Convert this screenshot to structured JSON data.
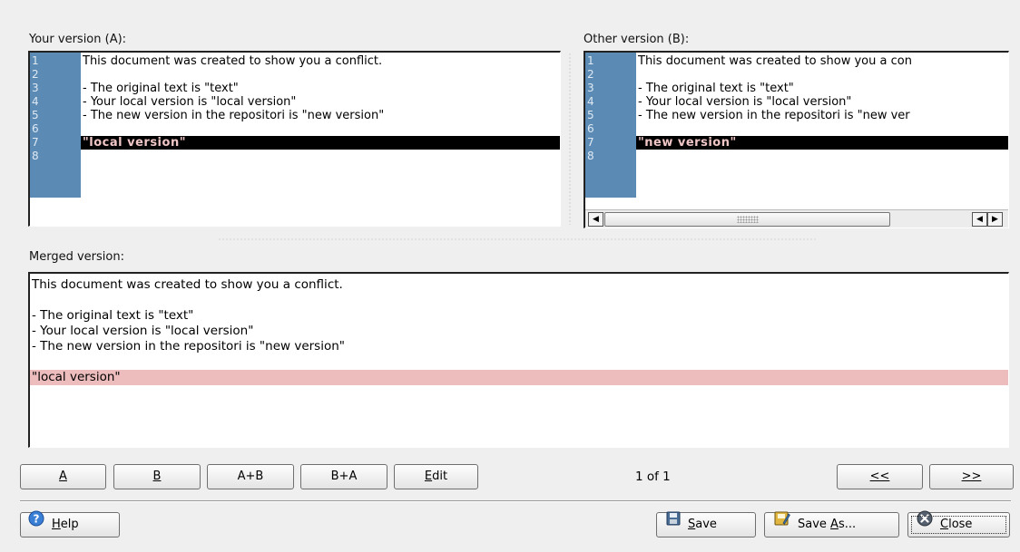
{
  "pane_a": {
    "label": "Your version (A):",
    "lines": [
      {
        "num": "1",
        "text": "This document was created to show you a conflict."
      },
      {
        "num": "2",
        "text": ""
      },
      {
        "num": "3",
        "text": "- The original text is \"text\""
      },
      {
        "num": "4",
        "text": "- Your local version is \"local version\""
      },
      {
        "num": "5",
        "text": "- The new version in the repositori is \"new version\""
      },
      {
        "num": "6",
        "text": ""
      },
      {
        "num": "7",
        "text": "\"local version\""
      },
      {
        "num": "8",
        "text": ""
      }
    ]
  },
  "pane_b": {
    "label": "Other version (B):",
    "lines": [
      {
        "num": "1",
        "text": "This document was created to show you a con"
      },
      {
        "num": "2",
        "text": ""
      },
      {
        "num": "3",
        "text": "- The original text is \"text\""
      },
      {
        "num": "4",
        "text": "- Your local version is \"local version\""
      },
      {
        "num": "5",
        "text": "- The new version in the repositori is \"new ver"
      },
      {
        "num": "6",
        "text": ""
      },
      {
        "num": "7",
        "text": "\"new version\""
      },
      {
        "num": "8",
        "text": ""
      }
    ],
    "scroll_left_glyph": "◀",
    "scroll_right_glyph": "▶"
  },
  "merged": {
    "label": "Merged version:",
    "lines": [
      "This document was created to show you a conflict.",
      "",
      "- The original text is \"text\"",
      "- Your local version is \"local version\"",
      "- The new version in the repositori is \"new version\"",
      "",
      "\"local version\""
    ]
  },
  "toolbar": {
    "a_label": "A",
    "b_label": "B",
    "a_plus_b_label": "A+B",
    "b_plus_a_label": "B+A",
    "edit_label": "Edit",
    "conflict_status": "1 of 1",
    "prev_label": "<<",
    "next_label": ">>"
  },
  "footer": {
    "help_label": "Help",
    "save_label": "Save",
    "save_as_label": "Save As...",
    "close_label": "Close"
  },
  "colors": {
    "gutter": "#5b8bb5",
    "conflict_line": "#000000",
    "conflict_text": "#f0c6c6",
    "merged_conflict": "#edbcbc"
  },
  "icons": {
    "help": "help-icon",
    "save": "floppy-disk-icon",
    "save_as": "save-as-icon",
    "close": "close-icon"
  }
}
